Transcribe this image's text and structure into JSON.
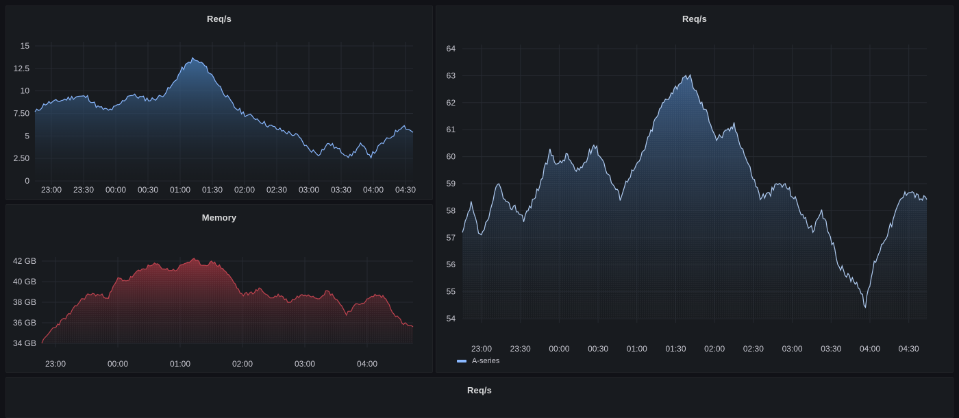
{
  "panels": {
    "req_top_left": {
      "title": "Req/s"
    },
    "memory": {
      "title": "Memory"
    },
    "req_right": {
      "title": "Req/s",
      "legend": "A-series"
    },
    "req_bottom": {
      "title": "Req/s"
    }
  },
  "colors": {
    "background": "#111217",
    "panel": "#181b1f",
    "blue_series": "#8ab8ff",
    "red_series": "#8c2f39",
    "grid": "#2a2d33"
  },
  "chart_data": [
    {
      "id": "req_top_left",
      "type": "area",
      "title": "Req/s",
      "x_ticks": [
        "23:00",
        "23:30",
        "00:00",
        "00:30",
        "01:00",
        "01:30",
        "02:00",
        "02:30",
        "03:00",
        "03:30",
        "04:00",
        "04:30"
      ],
      "y_ticks": [
        "0",
        "2.50",
        "5",
        "7.50",
        "10",
        "12.5",
        "15"
      ],
      "ylim": [
        0,
        15
      ],
      "series": [
        {
          "color": "#8ab8ff",
          "values": [
            7.6,
            8.6,
            8.8,
            9.1,
            9.4,
            9.3,
            8.2,
            7.8,
            8.4,
            9.6,
            9.3,
            9.0,
            9.4,
            10.5,
            12.4,
            13.5,
            13.0,
            11.5,
            9.8,
            8.2,
            7.4,
            7.0,
            6.3,
            5.8,
            5.4,
            5.0,
            3.6,
            3.0,
            4.2,
            3.4,
            2.7,
            4.0,
            2.8,
            4.1,
            5.0,
            6.2,
            5.4
          ]
        }
      ]
    },
    {
      "id": "memory",
      "type": "area",
      "title": "Memory",
      "x_ticks": [
        "23:00",
        "00:00",
        "01:00",
        "02:00",
        "03:00",
        "04:00"
      ],
      "y_ticks": [
        "34 GB",
        "36 GB",
        "38 GB",
        "40 GB",
        "42 GB"
      ],
      "ylim": [
        34,
        42
      ],
      "series": [
        {
          "color": "#c4162a",
          "values": [
            34.0,
            35.3,
            36.1,
            36.9,
            38.1,
            38.8,
            38.7,
            38.5,
            40.3,
            40.1,
            40.9,
            41.4,
            41.7,
            41.2,
            41.1,
            41.8,
            42.1,
            41.6,
            41.9,
            41.3,
            40.2,
            38.7,
            38.9,
            39.3,
            38.4,
            38.7,
            38.0,
            38.6,
            38.8,
            38.4,
            39.1,
            38.3,
            36.9,
            37.7,
            38.1,
            38.7,
            38.5,
            36.9,
            35.9,
            35.6
          ]
        }
      ]
    },
    {
      "id": "req_right",
      "type": "area",
      "title": "Req/s",
      "x_ticks": [
        "23:00",
        "23:30",
        "00:00",
        "00:30",
        "01:00",
        "01:30",
        "02:00",
        "02:30",
        "03:00",
        "03:30",
        "04:00",
        "04:30"
      ],
      "y_ticks": [
        "54",
        "55",
        "56",
        "57",
        "58",
        "59",
        "60",
        "61",
        "62",
        "63",
        "64"
      ],
      "ylim": [
        53.8,
        64
      ],
      "series": [
        {
          "name": "A-series",
          "color": "#8ab8ff",
          "values": [
            57.0,
            58.1,
            56.9,
            57.5,
            59.0,
            58.1,
            58.0,
            57.6,
            58.2,
            59.0,
            60.1,
            59.6,
            60.0,
            59.3,
            59.7,
            60.4,
            59.8,
            59.0,
            58.4,
            59.2,
            59.6,
            60.4,
            61.3,
            62.0,
            62.4,
            62.8,
            62.9,
            62.1,
            61.5,
            60.6,
            60.8,
            61.1,
            60.2,
            59.3,
            58.4,
            58.5,
            58.9,
            58.8,
            58.3,
            57.6,
            57.1,
            57.8,
            56.9,
            55.8,
            55.4,
            55.2,
            54.3,
            55.9,
            56.7,
            57.4,
            58.3,
            58.7,
            58.4,
            58.3
          ]
        }
      ]
    },
    {
      "id": "req_bottom",
      "type": "area",
      "title": "Req/s",
      "series": []
    }
  ]
}
